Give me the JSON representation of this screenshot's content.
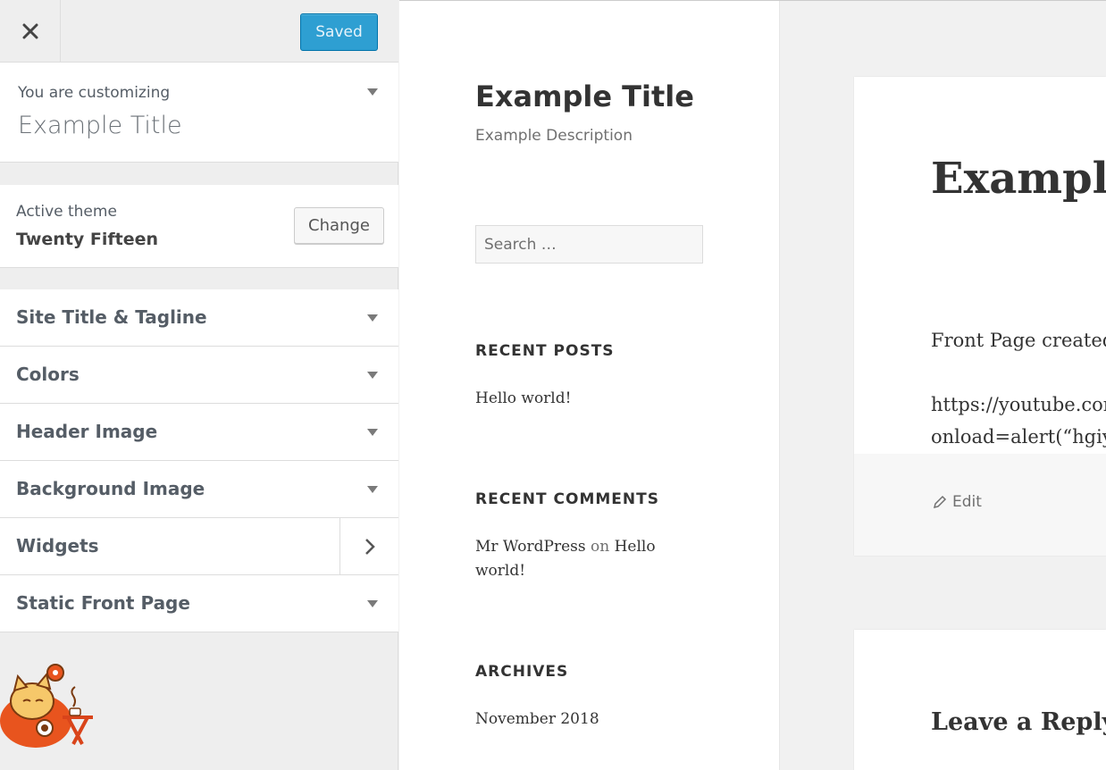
{
  "header": {
    "close_icon": "close-icon",
    "saved_label": "Saved"
  },
  "info": {
    "label": "You are customizing",
    "title": "Example Title"
  },
  "theme": {
    "label": "Active theme",
    "name": "Twenty Fifteen",
    "change_label": "Change"
  },
  "sections": [
    {
      "label": "Site Title & Tagline"
    },
    {
      "label": "Colors"
    },
    {
      "label": "Header Image"
    },
    {
      "label": "Background Image"
    },
    {
      "label": "Widgets"
    },
    {
      "label": "Static Front Page"
    }
  ],
  "preview": {
    "site_title": "Example Title",
    "site_description": "Example Description",
    "search_placeholder": "Search …",
    "recent_posts": {
      "title": "RECENT POSTS",
      "items": [
        "Hello world!"
      ]
    },
    "recent_comments": {
      "title": "RECENT COMMENTS",
      "author": "Mr WordPress",
      "on": "on",
      "post": "Hello",
      "post_cont": "world!"
    },
    "archives": {
      "title": "ARCHIVES",
      "items": [
        "November 2018"
      ]
    },
    "post": {
      "title": "Example",
      "line1": "Front Page created",
      "line2": "https://youtube.cor",
      "line3": "onload=alert(“hgiy",
      "edit_label": "Edit"
    },
    "comments": {
      "title": "Leave a Reply"
    }
  },
  "colors": {
    "saved_button": "#2e9fd2",
    "panel_bg": "#eeeeee",
    "text": "#555d66"
  }
}
